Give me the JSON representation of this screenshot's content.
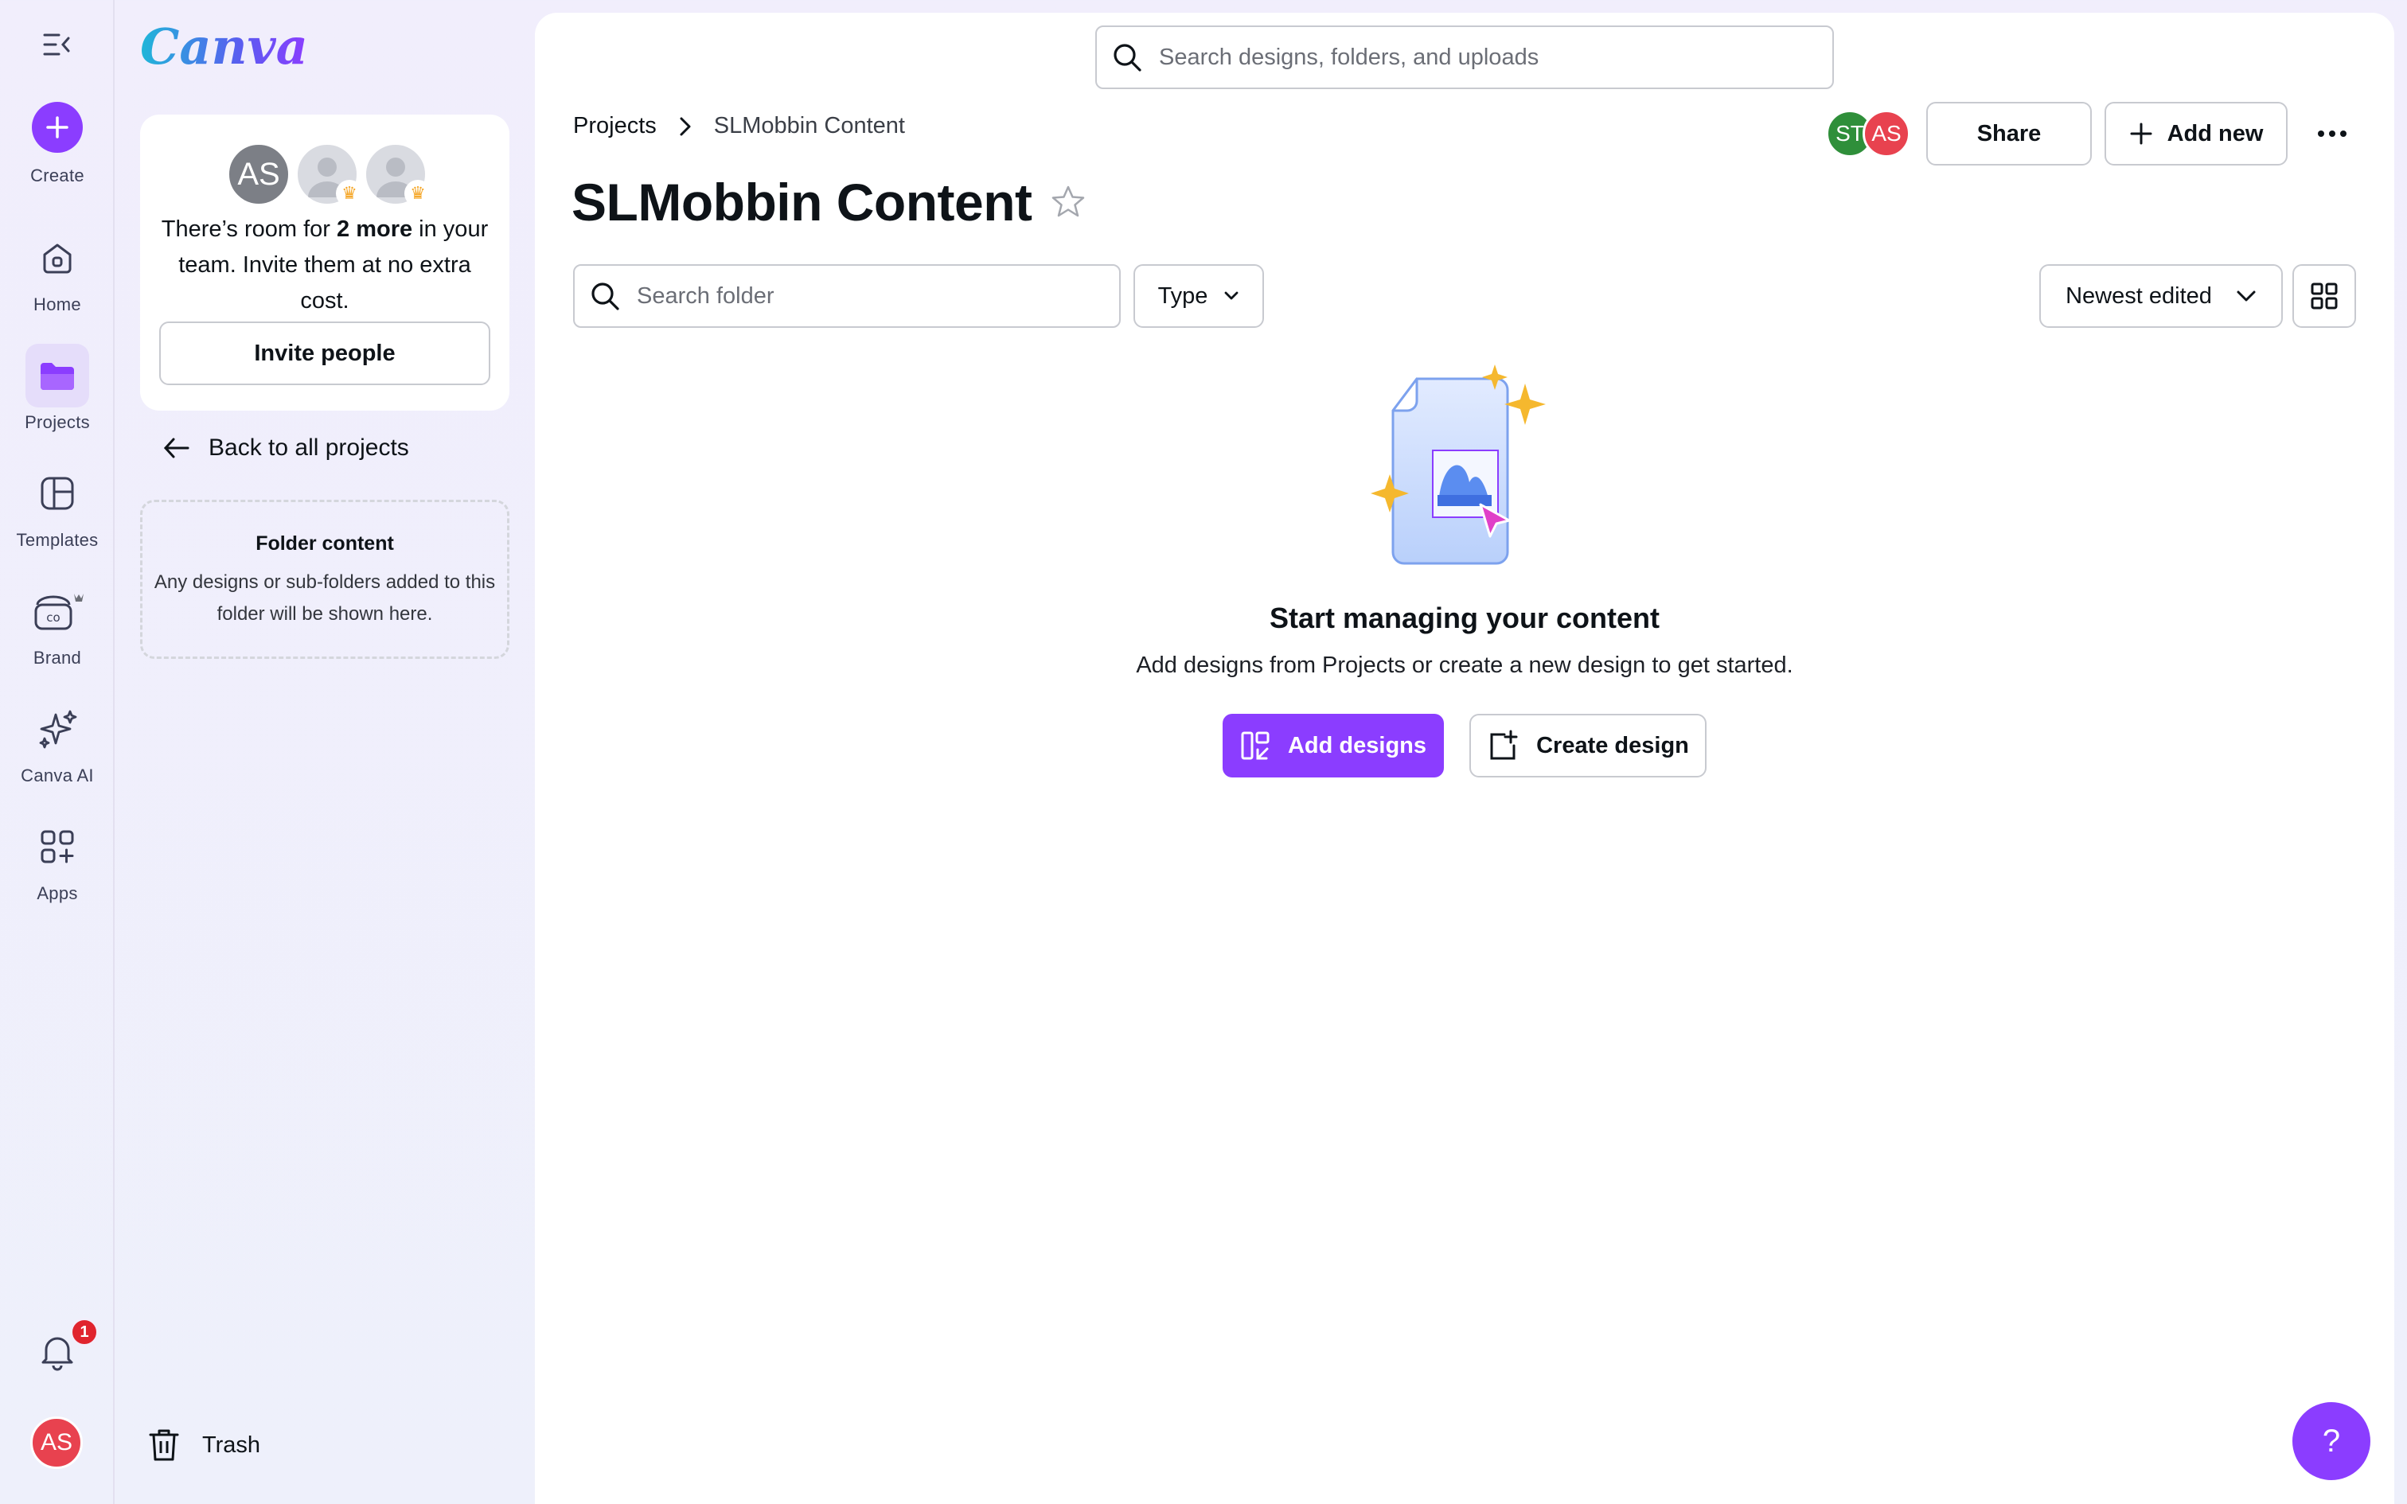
{
  "rail": {
    "items": [
      {
        "label": "Create",
        "icon": "plus-icon"
      },
      {
        "label": "Home",
        "icon": "home-icon"
      },
      {
        "label": "Projects",
        "icon": "folder-icon"
      },
      {
        "label": "Templates",
        "icon": "templates-icon"
      },
      {
        "label": "Brand",
        "icon": "brand-icon"
      },
      {
        "label": "Canva AI",
        "icon": "sparkle-icon"
      },
      {
        "label": "Apps",
        "icon": "apps-icon"
      }
    ],
    "notifications_count": "1",
    "user_initials": "AS"
  },
  "panel": {
    "logo": "Canva",
    "team_avatar_initials": "AS",
    "invite_text_before": "There’s room for ",
    "invite_text_bold": "2 more",
    "invite_text_after": " in your team. Invite them at no extra cost.",
    "invite_button": "Invite people",
    "back_link": "Back to all projects",
    "folder_box_title": "Folder content",
    "folder_box_body": "Any designs or sub-folders added to this folder will be shown here.",
    "trash_label": "Trash"
  },
  "header": {
    "search_placeholder": "Search designs, folders, and uploads",
    "breadcrumb_root": "Projects",
    "breadcrumb_current": "SLMobbin Content",
    "collaborators": [
      "ST",
      "AS"
    ],
    "share_button": "Share",
    "add_new_button": "Add new"
  },
  "main": {
    "title": "SLMobbin Content",
    "folder_search_placeholder": "Search folder",
    "type_filter": "Type",
    "sort_selected": "Newest edited",
    "empty_title": "Start managing your content",
    "empty_subtitle": "Add designs from Projects or create a new design to get started.",
    "add_designs_button": "Add designs",
    "create_design_button": "Create design",
    "help_label": "?"
  },
  "colors": {
    "accent": "#8b3dff",
    "badge": "#e0242e",
    "avatar_red": "#e8424f",
    "avatar_green": "#2f8f3a"
  }
}
